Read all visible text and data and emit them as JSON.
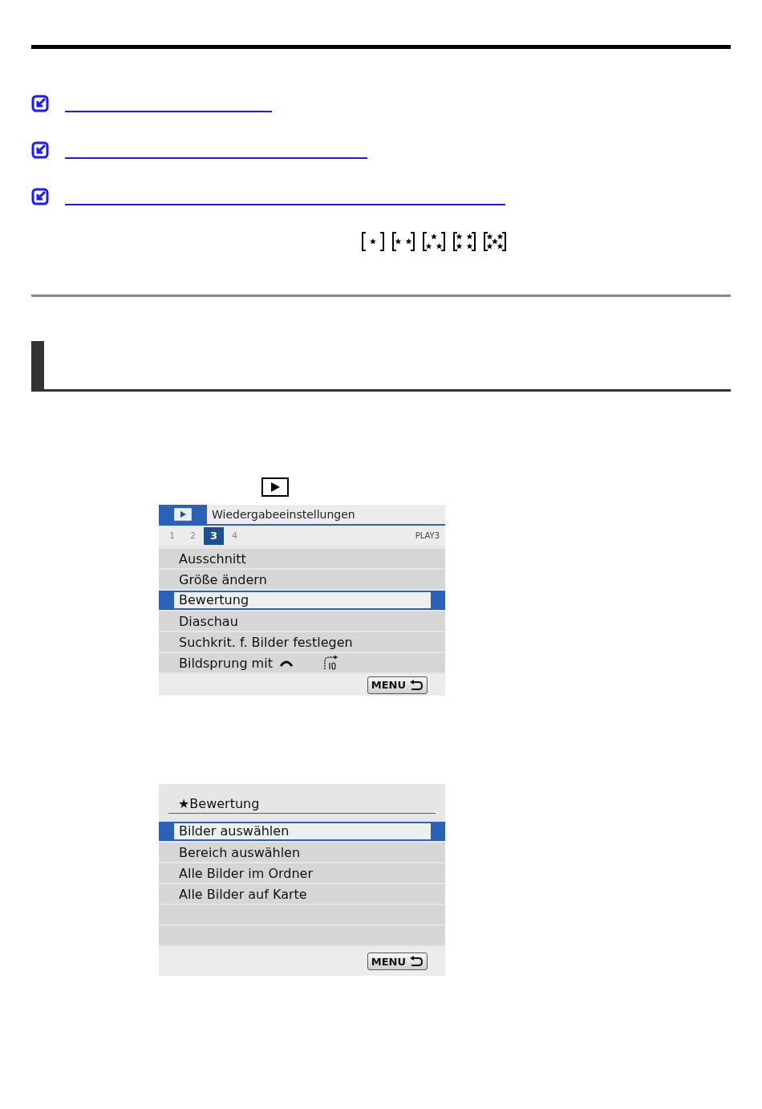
{
  "links": [
    {
      "kind": "link"
    },
    {
      "kind": "link"
    },
    {
      "kind": "link"
    }
  ],
  "rating_icons": [
    {
      "kind": "one"
    },
    {
      "kind": "two"
    },
    {
      "kind": "three"
    },
    {
      "kind": "four"
    },
    {
      "kind": "five"
    }
  ],
  "menu": {
    "title": "Wiedergabeeinstellungen",
    "page_label": "PLAY3",
    "tabs": [
      {
        "label": "1",
        "selected": false
      },
      {
        "label": "2",
        "selected": false
      },
      {
        "label": "3",
        "selected": true
      },
      {
        "label": "4",
        "selected": false
      }
    ],
    "items": [
      {
        "label": "Ausschnitt",
        "selected": false
      },
      {
        "label": "Größe ändern",
        "selected": false
      },
      {
        "label": "Bewertung",
        "selected": true
      },
      {
        "label": "Diaschau",
        "selected": false
      },
      {
        "label": "Suchkrit. f. Bilder festlegen",
        "selected": false
      },
      {
        "label": "Bildsprung mit",
        "selected": false,
        "kind": "jump"
      }
    ],
    "back_button": "MENU"
  },
  "rating_menu": {
    "title": "★Bewertung",
    "items": [
      {
        "label": "Bilder auswählen",
        "selected": true
      },
      {
        "label": "Bereich auswählen",
        "selected": false
      },
      {
        "label": "Alle Bilder im Ordner",
        "selected": false
      },
      {
        "label": "Alle Bilder auf Karte",
        "selected": false
      }
    ],
    "back_button": "MENU"
  }
}
